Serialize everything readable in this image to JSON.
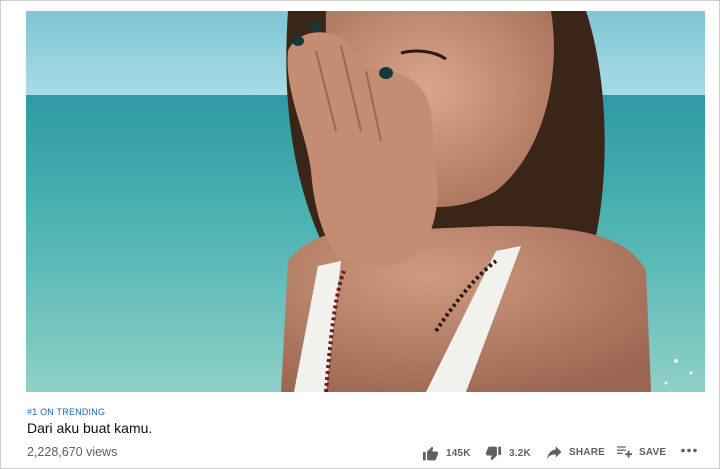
{
  "video": {
    "trending_badge": "#1 ON TRENDING",
    "title": "Dari aku buat kamu.",
    "views": "2,228,670 views"
  },
  "actions": {
    "like_count": "145K",
    "dislike_count": "3.2K",
    "share_label": "SHARE",
    "save_label": "SAVE"
  },
  "icons": {
    "like": "thumbs-up-icon",
    "dislike": "thumbs-down-icon",
    "share": "share-arrow-icon",
    "save": "playlist-add-icon",
    "more": "more-horizontal-icon"
  },
  "colors": {
    "trending_link": "#1e63c8",
    "title_text": "#0f0f0f",
    "meta_text": "#606060"
  }
}
